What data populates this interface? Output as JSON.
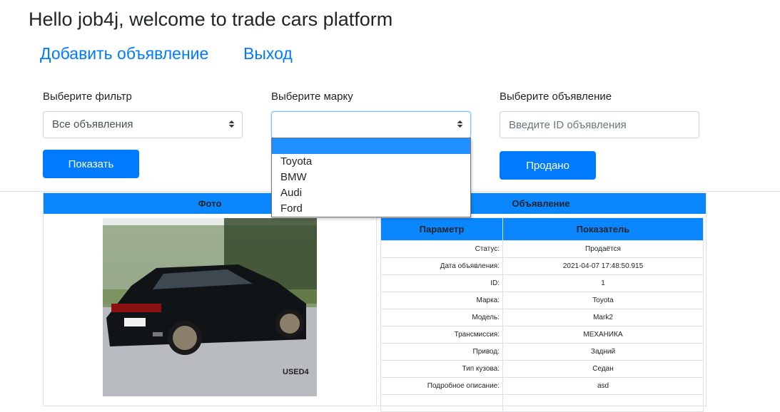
{
  "header": {
    "title": "Hello job4j, welcome to trade cars platform",
    "nav": {
      "add_ad": "Добавить объявление",
      "logout": "Выход"
    }
  },
  "filters": {
    "filter_label": "Выберите фильтр",
    "filter_value": "Все объявления",
    "brand_label": "Выберите марку",
    "brand_value": "",
    "ad_label": "Выберите объявление",
    "ad_placeholder": "Введите ID объявления",
    "show_button": "Показать",
    "sold_button": "Продано"
  },
  "brand_dropdown": {
    "options": [
      "",
      "Toyota",
      "BMW",
      "Audi",
      "Ford"
    ],
    "selected_index": 0
  },
  "listing_table": {
    "col_photo": "Фото",
    "col_ad": "Объявление",
    "photo_plate_text": "USED4",
    "details": {
      "header_param": "Параметр",
      "header_value": "Показатель",
      "rows": [
        {
          "param": "Статус:",
          "value": "Продаётся"
        },
        {
          "param": "Дата объявления:",
          "value": "2021-04-07 17:48:50.915"
        },
        {
          "param": "ID:",
          "value": "1"
        },
        {
          "param": "Марка:",
          "value": "Toyota"
        },
        {
          "param": "Модель:",
          "value": "Mark2"
        },
        {
          "param": "Трансмиссия:",
          "value": "МЕХАНИКА"
        },
        {
          "param": "Привод:",
          "value": "Задний"
        },
        {
          "param": "Тип кузова:",
          "value": "Седан"
        },
        {
          "param": "Подробное описание:",
          "value": "asd"
        },
        {
          "param": "",
          "value": ""
        }
      ]
    }
  },
  "colors": {
    "accent": "#007bff",
    "table_header": "#0a86ff",
    "dropdown_highlight": "#1e90ff"
  }
}
